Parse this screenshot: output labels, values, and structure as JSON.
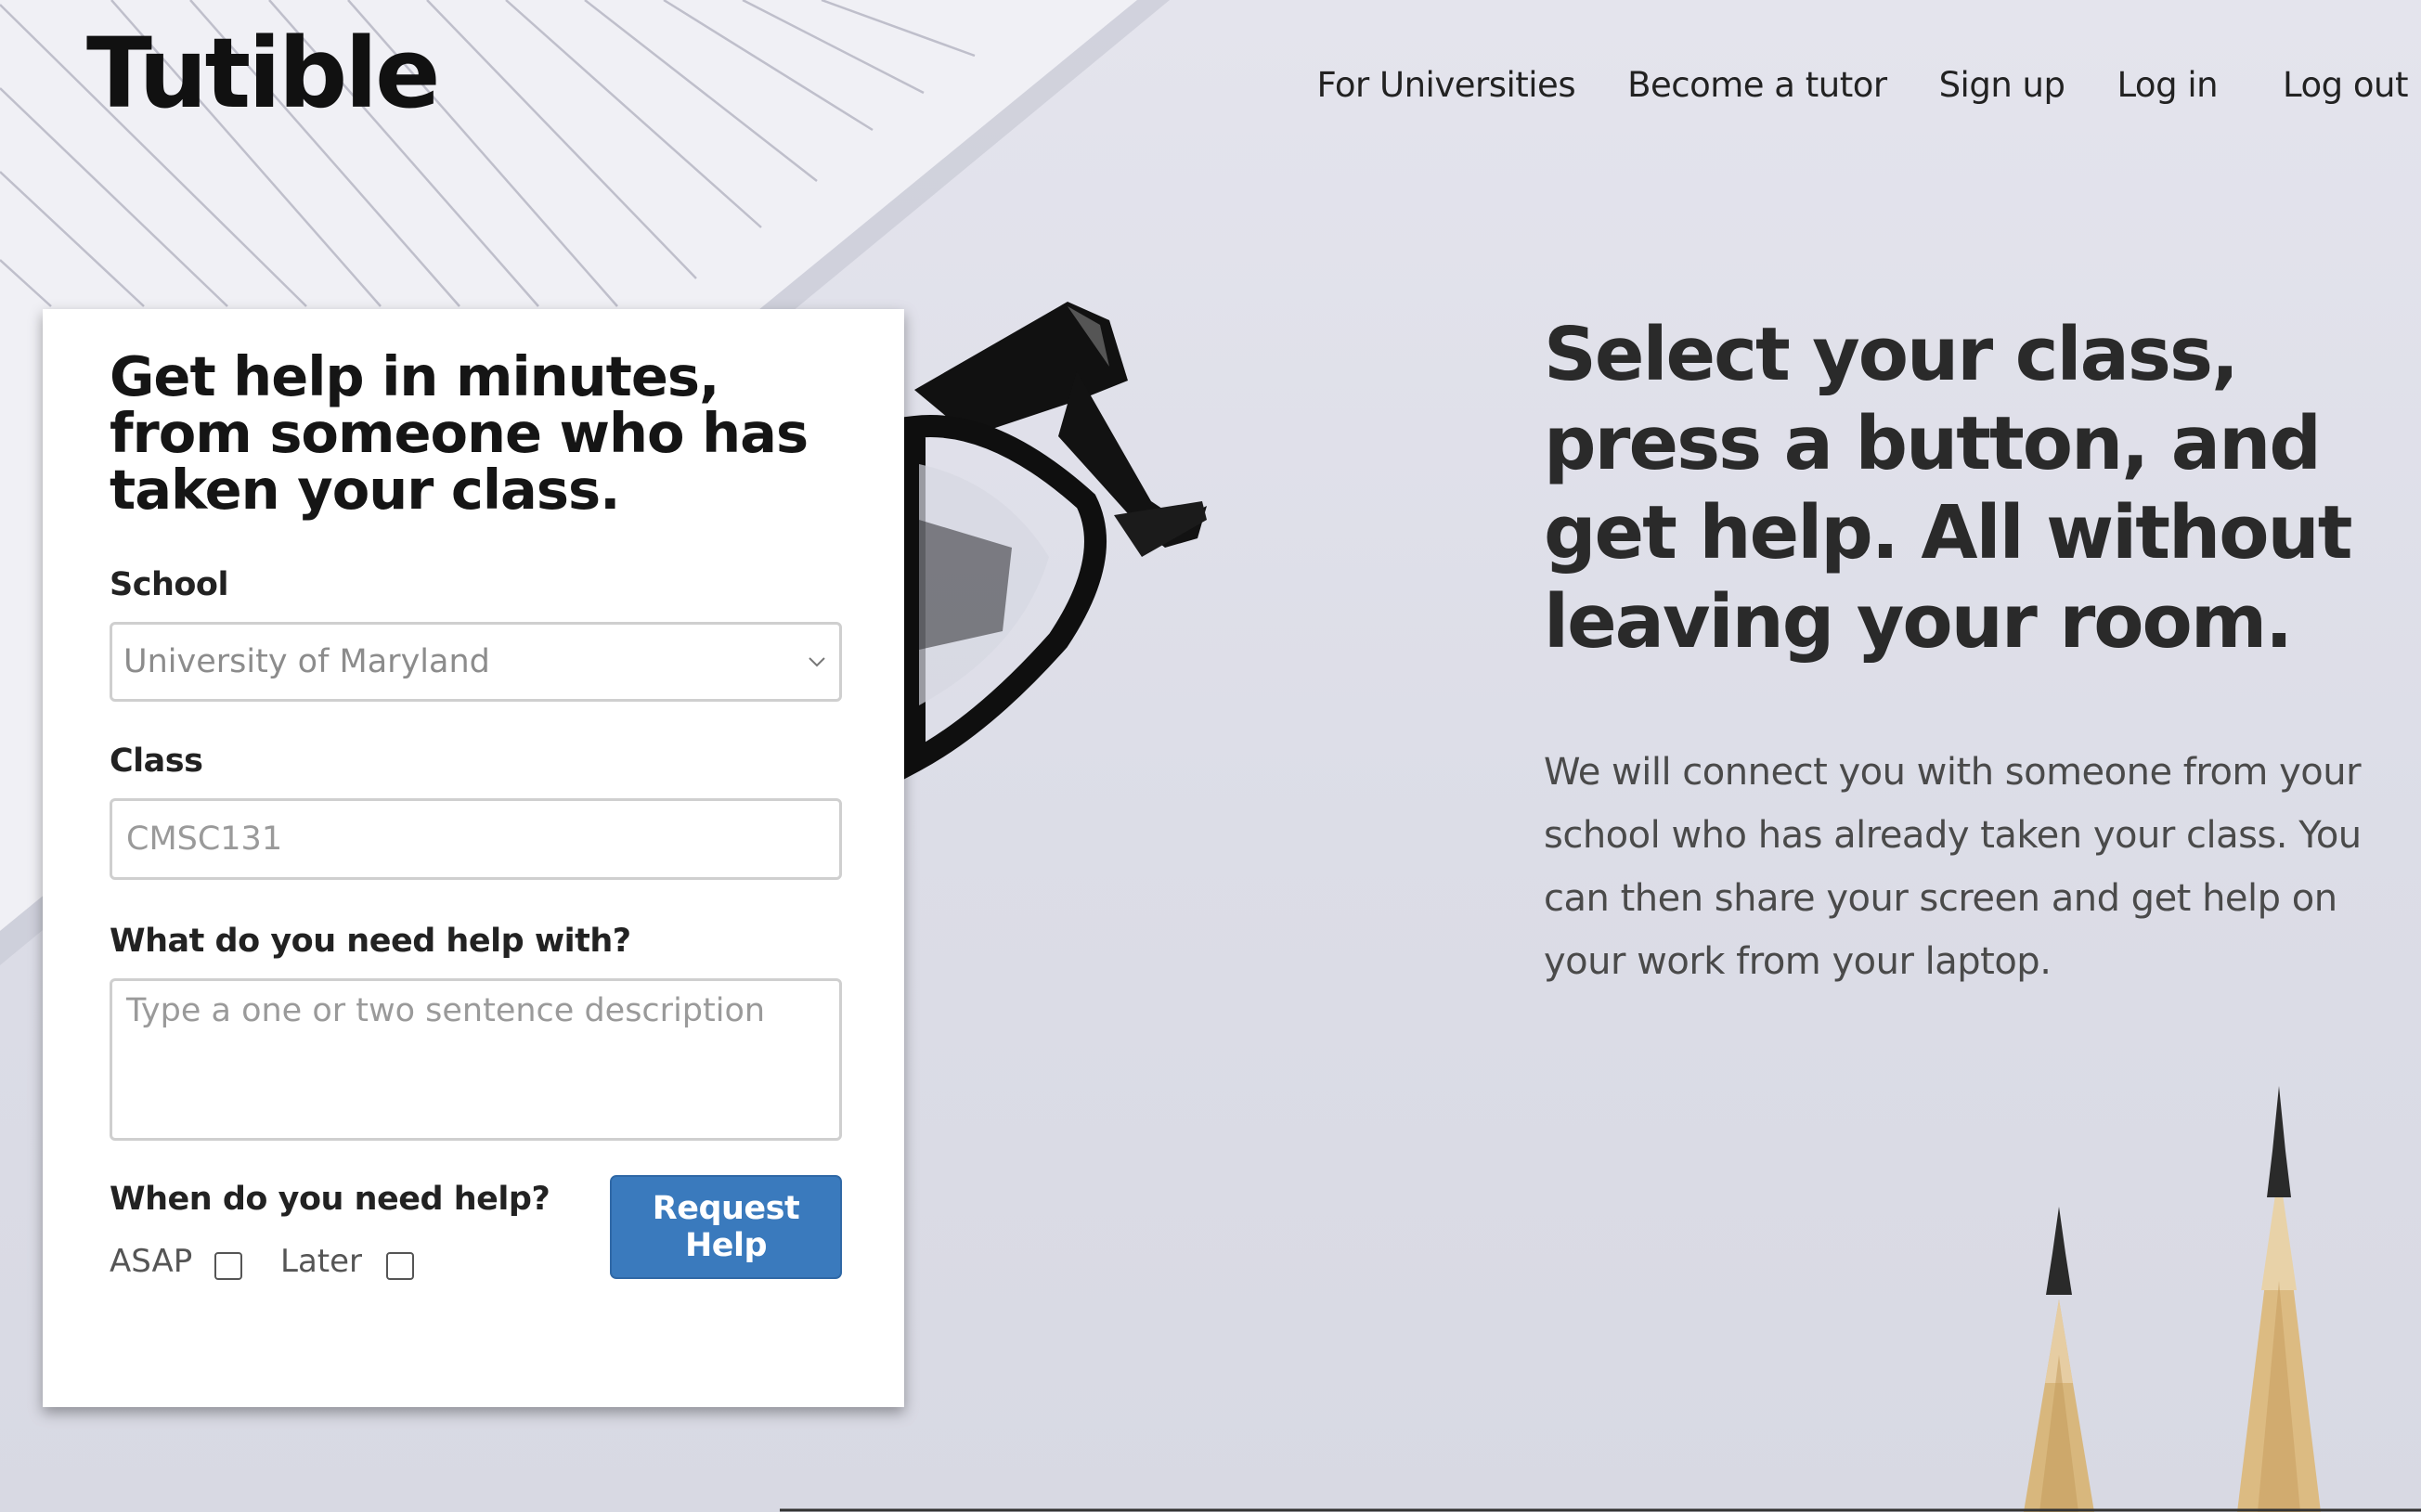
{
  "header": {
    "logo": "Tutible",
    "nav": [
      {
        "label": "For Universities"
      },
      {
        "label": "Become a tutor"
      },
      {
        "label": "Sign up"
      },
      {
        "label": "Log in"
      },
      {
        "label": "Log out"
      }
    ]
  },
  "form": {
    "title": "Get help in minutes, from someone who has taken your class.",
    "school": {
      "label": "School",
      "value": "University of Maryland"
    },
    "class": {
      "label": "Class",
      "placeholder": "CMSC131",
      "value": ""
    },
    "help_with": {
      "label": "What do you need help with?",
      "placeholder": "Type a one or two sentence description"
    },
    "when": {
      "label": "When do you need help?",
      "options": [
        {
          "label": "ASAP",
          "checked": false
        },
        {
          "label": "Later",
          "checked": false
        }
      ]
    },
    "submit_label": "Request Help",
    "submit_color": "#3a7abd"
  },
  "hero": {
    "heading": "Select your class, press a button, and get help. All without leaving your room.",
    "body": "We will connect you with someone from your school who has already taken your class. You can then share your screen and get help on your work from your laptop."
  }
}
